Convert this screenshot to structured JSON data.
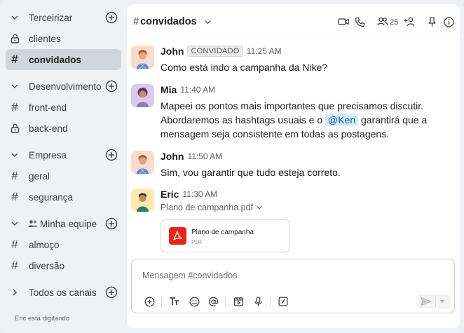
{
  "sidebar": {
    "items": [
      {
        "type": "section",
        "label": "Terceirizar",
        "icon": "chevron-down-icon",
        "addable": true
      },
      {
        "type": "channel",
        "label": "clientes",
        "icon": "lock-icon",
        "active": false
      },
      {
        "type": "channel",
        "label": "convidados",
        "icon": "hash-icon",
        "active": true
      },
      {
        "type": "section",
        "label": "Desenvolvimento",
        "icon": "chevron-down-icon",
        "addable": true
      },
      {
        "type": "channel",
        "label": "front-end",
        "icon": "hash-icon"
      },
      {
        "type": "channel",
        "label": "back-end",
        "icon": "lock-icon"
      },
      {
        "type": "section",
        "label": "Empresa",
        "icon": "chevron-down-icon",
        "addable": true
      },
      {
        "type": "channel",
        "label": "geral",
        "icon": "hash-icon"
      },
      {
        "type": "channel",
        "label": "segurança",
        "icon": "hash-icon"
      },
      {
        "type": "section",
        "label": "Minha equipe",
        "icon": "chevron-down-icon",
        "prefix_icon": "people-emoji-icon",
        "addable": true
      },
      {
        "type": "channel",
        "label": "almoço",
        "icon": "hash-icon"
      },
      {
        "type": "channel",
        "label": "diversão",
        "icon": "hash-icon"
      },
      {
        "type": "section",
        "label": "Todos os canais",
        "icon": "chevron-right-icon",
        "addable": true
      }
    ]
  },
  "header": {
    "hash": "#",
    "channel_name": "convidados",
    "member_count": "25",
    "icons": [
      "video-icon",
      "phone-icon",
      "members-icon",
      "add-member-icon",
      "pin-icon",
      "info-icon"
    ]
  },
  "messages": [
    {
      "author": "John",
      "badge": "CONVIDADO",
      "time": "11:25 AM",
      "lines": [
        "Como está indo a campanha da Nike?"
      ]
    },
    {
      "author": "Mia",
      "time": "11:40 AM",
      "line1": "Mapeei os pontos mais importantes que precisamos discutir.",
      "line2_before": "Abordaremos as hashtags usuais e o",
      "mention": "@Ken",
      "line2_after": "garantirá que a",
      "line3": "mensagem seja consistente em todas as postagens."
    },
    {
      "author": "John",
      "time": "11:50 AM",
      "lines": [
        "Sim, vou garantir que tudo esteja correto."
      ]
    },
    {
      "author": "Eric",
      "time": "11:30 AM",
      "file_label": "Plano de campanha.pdf",
      "file_card_name": "Plano de campanha",
      "file_card_type": "PDF"
    }
  ],
  "composer": {
    "placeholder": "Mensagem #convidados",
    "tools": [
      "plus-icon",
      "text-format-icon",
      "emoji-icon",
      "mention-icon",
      "video-clip-icon",
      "microphone-icon",
      "slash-command-icon"
    ],
    "send_icon": "send-icon"
  },
  "typing_indicator": "Eric está digitando",
  "colors": {
    "active_bg": "#cfd6dd",
    "mention_bg": "#d6ecfb",
    "mention_fg": "#1264a3",
    "pdf_red": "#e8261b"
  }
}
